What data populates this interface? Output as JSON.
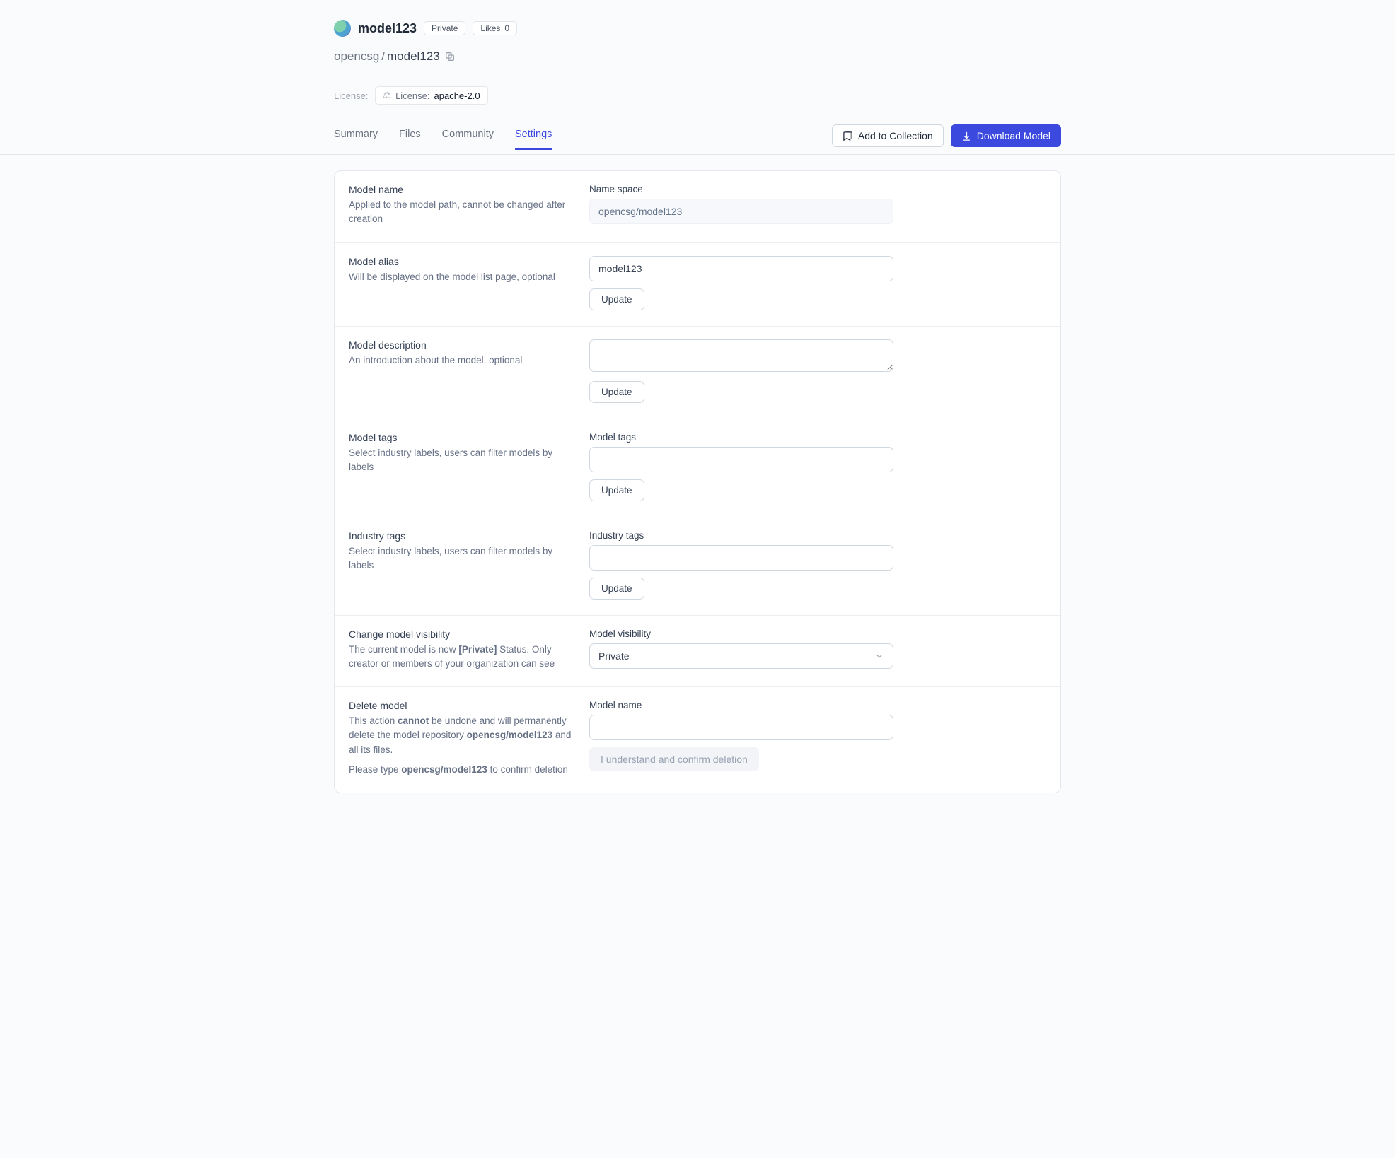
{
  "header": {
    "title": "model123",
    "private_badge": "Private",
    "likes_label": "Likes",
    "likes_count": "0",
    "breadcrumb_org": "opencsg",
    "breadcrumb_sep": " / ",
    "breadcrumb_name": "model123",
    "license_label": "License:",
    "license_pfx": "License:",
    "license_value": "apache-2.0"
  },
  "tabs": {
    "summary": "Summary",
    "files": "Files",
    "community": "Community",
    "settings": "Settings"
  },
  "actions": {
    "add_collection": "Add to Collection",
    "download": "Download Model"
  },
  "settings_rows": {
    "name": {
      "title": "Model name",
      "desc": "Applied to the model path, cannot be changed after creation",
      "field_label": "Name space",
      "value": "opencsg/model123"
    },
    "alias": {
      "title": "Model alias",
      "desc": "Will be displayed on the model list page, optional",
      "value": "model123",
      "button": "Update"
    },
    "description": {
      "title": "Model description",
      "desc": "An introduction about the model, optional",
      "value": "",
      "button": "Update"
    },
    "tags": {
      "title": "Model tags",
      "desc": "Select industry labels, users can filter models by labels",
      "field_label": "Model tags",
      "button": "Update"
    },
    "industry": {
      "title": "Industry tags",
      "desc": "Select industry labels, users can filter models by labels",
      "field_label": "Industry tags",
      "button": "Update"
    },
    "visibility": {
      "title": "Change model visibility",
      "desc_pfx": "The current model is now ",
      "desc_status": "[Private]",
      "desc_sfx": " Status. Only creator or members of your organization can see",
      "field_label": "Model visibility",
      "value": "Private"
    },
    "delete": {
      "title": "Delete model",
      "desc_pfx": "This action ",
      "desc_bold1": "cannot",
      "desc_mid": " be undone and will permanently delete the model repository ",
      "desc_bold2": "opencsg/model123",
      "desc_sfx": " and all its files.",
      "confirm_pfx": "Please type ",
      "confirm_bold": "opencsg/model123",
      "confirm_sfx": " to confirm deletion",
      "field_label": "Model name",
      "button": "I understand and confirm deletion"
    }
  }
}
